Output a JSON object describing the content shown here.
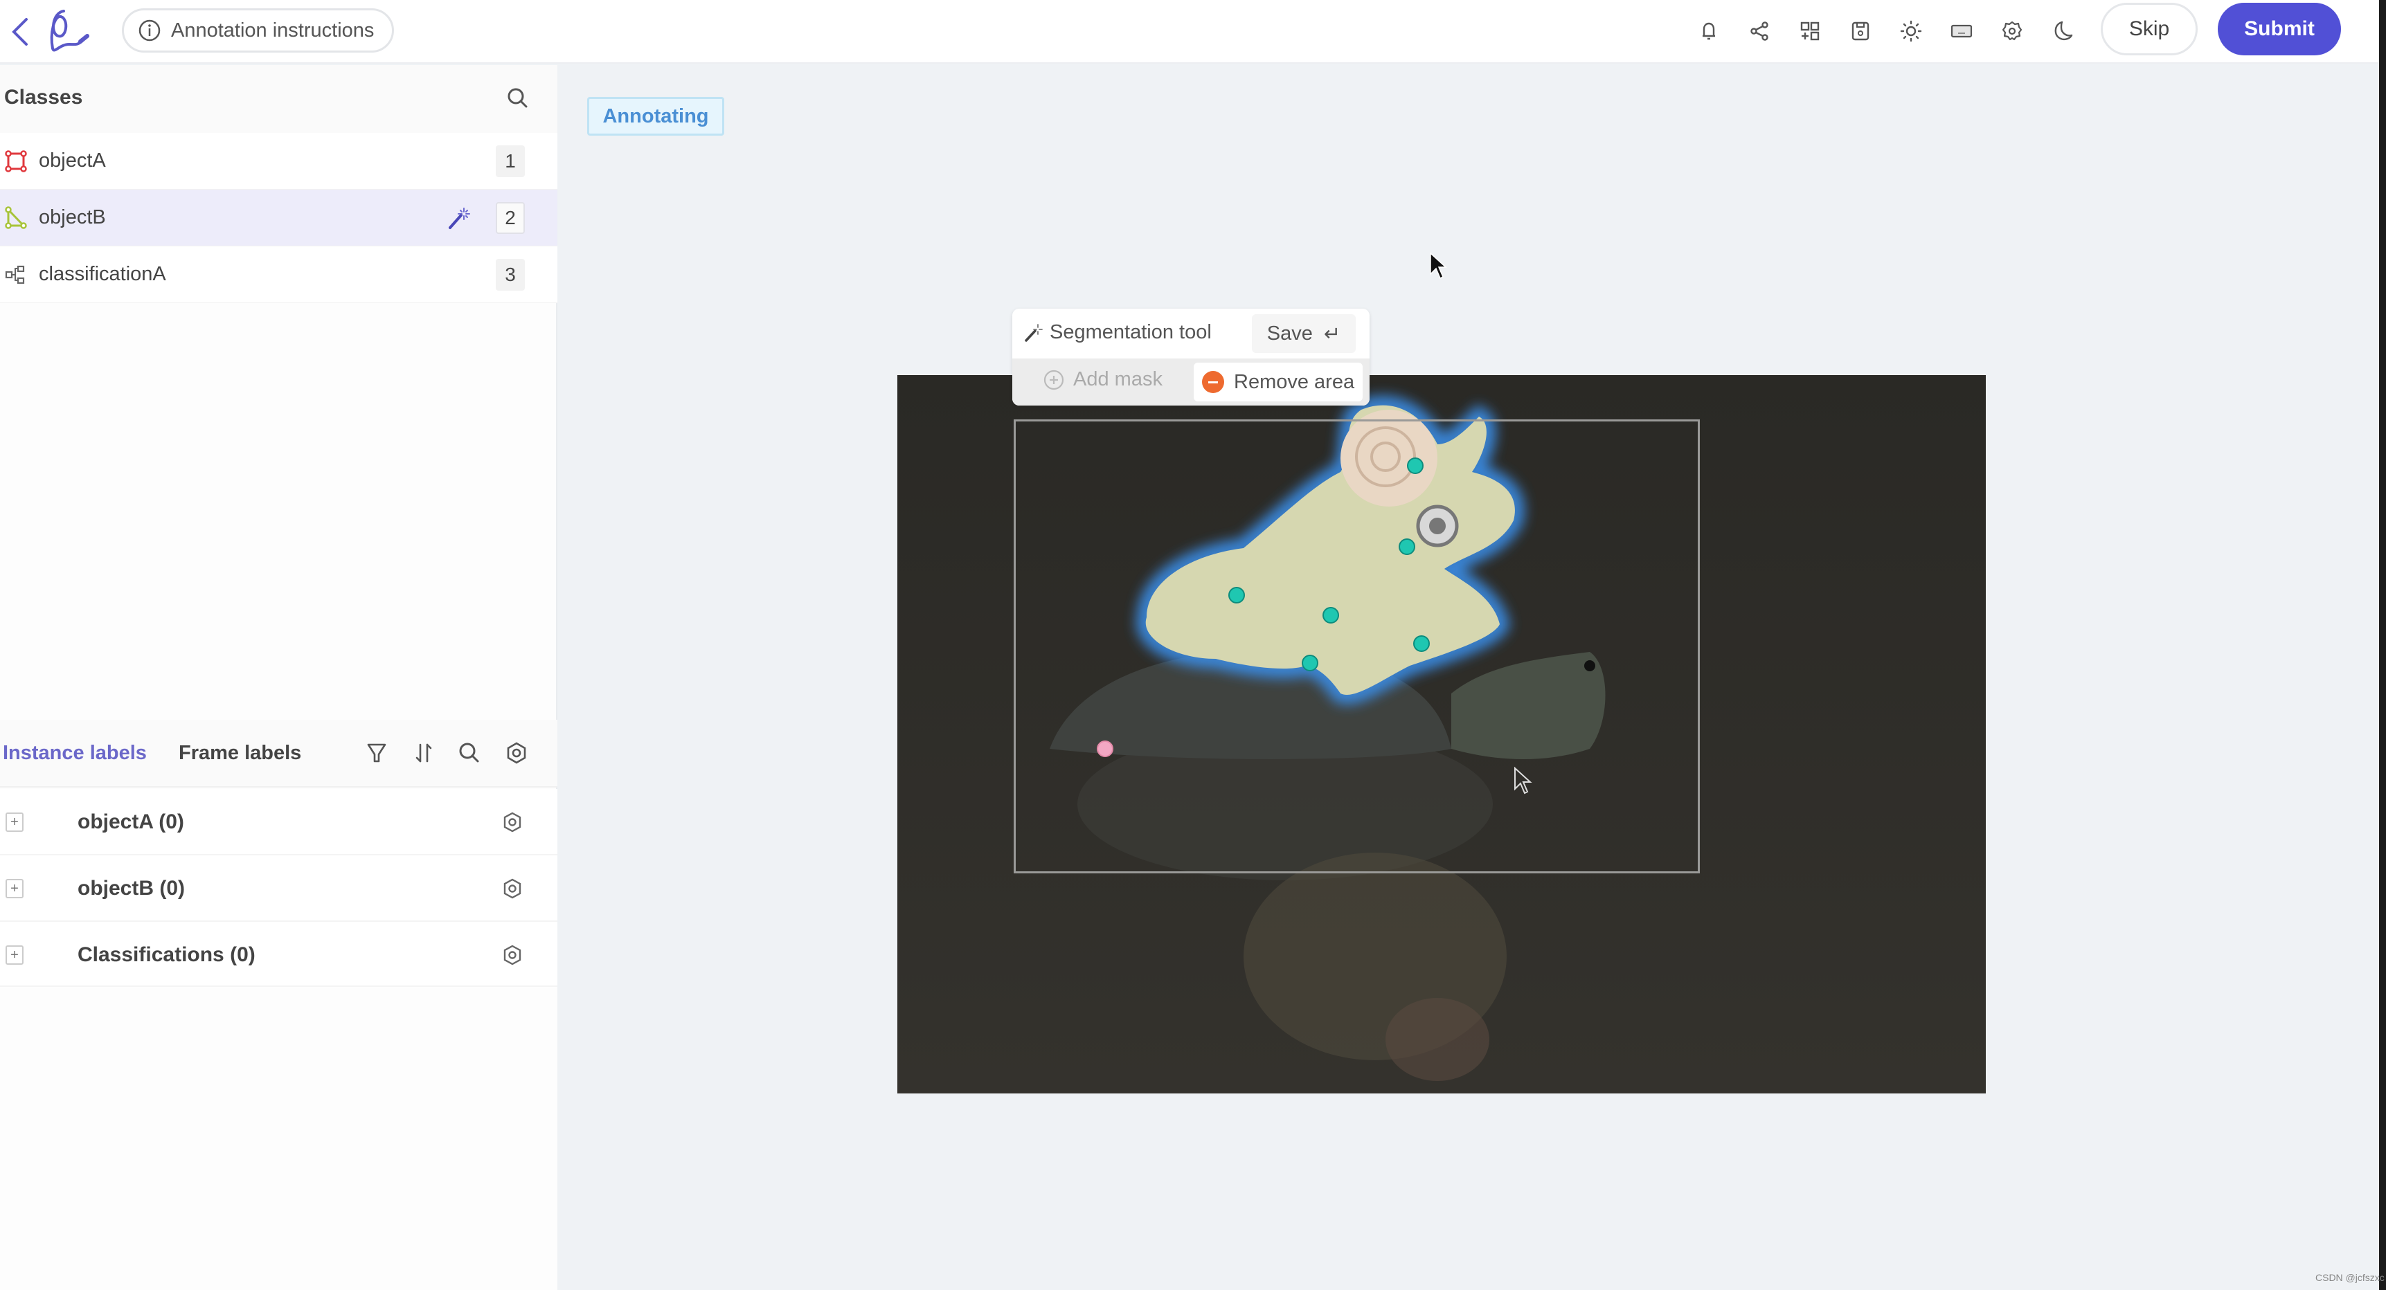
{
  "header": {
    "back_icon": "chevron-left-icon",
    "logo_icon": "brand-logo-icon",
    "instructions_label": "Annotation instructions",
    "instructions_icon": "info-icon",
    "toolbar_icons": [
      "bell-icon",
      "share-icon",
      "add-widget-icon",
      "save-file-icon",
      "brightness-icon",
      "keyboard-icon",
      "settings-gear-icon",
      "dark-mode-moon-icon"
    ],
    "skip_label": "Skip",
    "submit_label": "Submit",
    "accent_color": "#5150d6"
  },
  "classes": {
    "title": "Classes",
    "search_icon": "search-icon",
    "items": [
      {
        "label": "objectA",
        "hotkey": "1",
        "tool": "bounding-box",
        "color": "#e0393e",
        "active": false
      },
      {
        "label": "objectB",
        "hotkey": "2",
        "tool": "polygon",
        "color": "#a8c43a",
        "active": true,
        "tool_indicator": "magic-wand-icon"
      },
      {
        "label": "classificationA",
        "hotkey": "3",
        "tool": "classification",
        "color": "#777777",
        "active": false
      }
    ]
  },
  "labels_panel": {
    "tabs": [
      {
        "label": "Instance labels",
        "active": true
      },
      {
        "label": "Frame labels",
        "active": false
      }
    ],
    "actions": [
      "filter-icon",
      "sort-icon",
      "search-icon",
      "visibility-eye-icon"
    ],
    "groups": [
      {
        "label": "objectA (0)"
      },
      {
        "label": "objectB (0)"
      },
      {
        "label": "Classifications (0)"
      }
    ]
  },
  "canvas": {
    "status_badge": "Annotating",
    "segmentation_toolbar": {
      "title": "Segmentation tool",
      "save_label": "Save",
      "save_shortcut": "↵",
      "add_mask_label": "Add mask",
      "remove_area_label": "Remove area",
      "remove_color": "#ee6a2f"
    },
    "mask_color": "#3a8ee8",
    "positive_point_color": "#1fc7b1",
    "negative_point_color": "#f2a7c3"
  },
  "watermark": "CSDN @jcfszxc"
}
